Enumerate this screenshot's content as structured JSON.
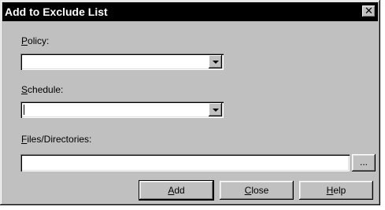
{
  "window": {
    "title": "Add to Exclude List",
    "close_glyph": "✕"
  },
  "fields": {
    "policy_label": "Policy:",
    "policy_value": "",
    "schedule_label": "Schedule:",
    "schedule_value": "",
    "files_label": "Files/Directories:",
    "files_value": ""
  },
  "buttons": {
    "browse": "...",
    "add": "Add",
    "close": "Close",
    "help": "Help"
  }
}
